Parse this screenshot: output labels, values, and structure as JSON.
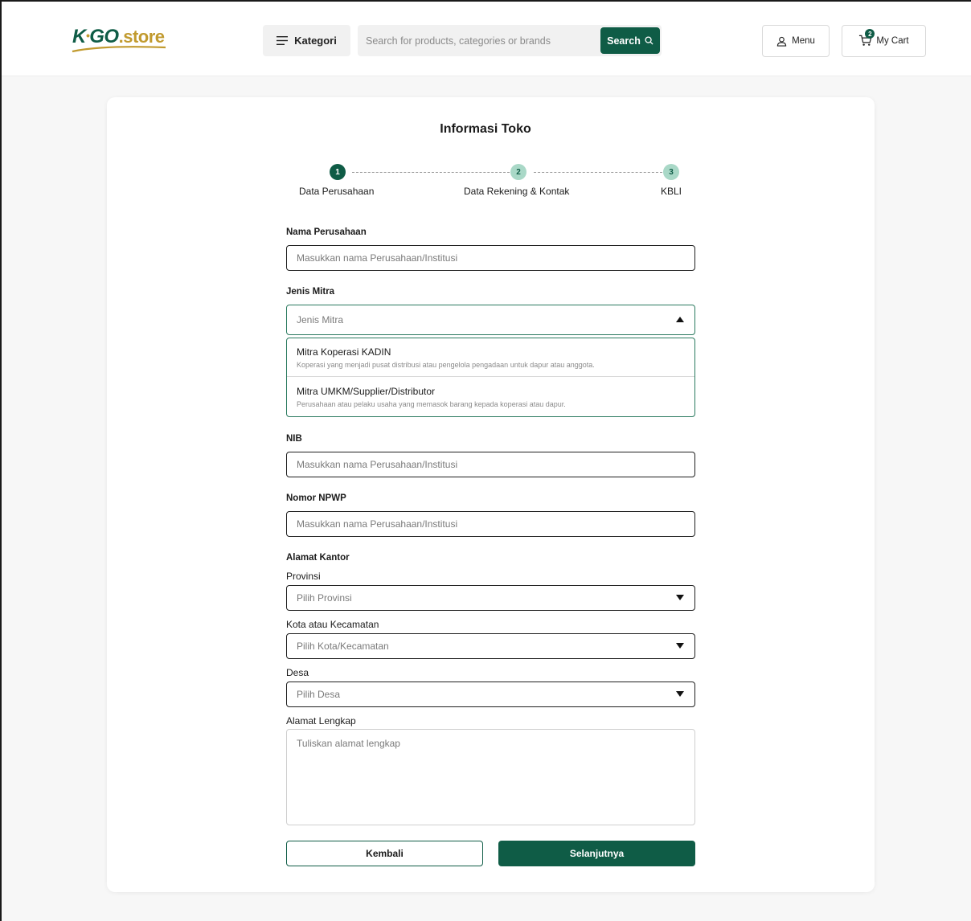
{
  "header": {
    "logo": {
      "k": "K",
      "go": "GO",
      "store": ".store"
    },
    "kategori_label": "Kategori",
    "search": {
      "placeholder": "Search for products, categories or brands",
      "button_label": "Search"
    },
    "menu_label": "Menu",
    "cart": {
      "label": "My Cart",
      "count": "2"
    }
  },
  "page": {
    "title": "Informasi Toko"
  },
  "stepper": {
    "steps": [
      {
        "number": "1",
        "label": "Data Perusahaan",
        "state": "active"
      },
      {
        "number": "2",
        "label": "Data Rekening & Kontak",
        "state": "inactive"
      },
      {
        "number": "3",
        "label": "KBLI",
        "state": "inactive"
      }
    ]
  },
  "form": {
    "nama_perusahaan": {
      "label": "Nama Perusahaan",
      "placeholder": "Masukkan nama Perusahaan/Institusi"
    },
    "jenis_mitra": {
      "label": "Jenis Mitra",
      "placeholder": "Jenis Mitra",
      "options": [
        {
          "title": "Mitra Koperasi KADIN",
          "description": "Koperasi yang menjadi pusat distribusi atau pengelola pengadaan untuk dapur atau anggota."
        },
        {
          "title": "Mitra UMKM/Supplier/Distributor",
          "description": "Perusahaan atau pelaku usaha yang memasok barang kepada koperasi atau dapur."
        }
      ]
    },
    "nib": {
      "label": "NIB",
      "placeholder": "Masukkan nama Perusahaan/Institusi"
    },
    "npwp": {
      "label": "Nomor NPWP",
      "placeholder": "Masukkan nama Perusahaan/Institusi"
    },
    "alamat": {
      "section_label": "Alamat Kantor",
      "provinsi": {
        "label": "Provinsi",
        "placeholder": "Pilih Provinsi"
      },
      "kota": {
        "label": "Kota atau Kecamatan",
        "placeholder": "Pilih Kota/Kecamatan"
      },
      "desa": {
        "label": "Desa",
        "placeholder": "Pilih Desa"
      },
      "lengkap": {
        "label": "Alamat Lengkap",
        "placeholder": "Tuliskan alamat lengkap"
      }
    },
    "buttons": {
      "back": "Kembali",
      "next": "Selanjutnya"
    }
  },
  "colors": {
    "primary": "#0f5c46",
    "accent": "#c19a2e",
    "step_inactive": "#a9d8c7"
  },
  "icons": [
    "hamburger-icon",
    "search-icon",
    "user-icon",
    "cart-icon",
    "caret-up-icon",
    "caret-down-icon"
  ]
}
